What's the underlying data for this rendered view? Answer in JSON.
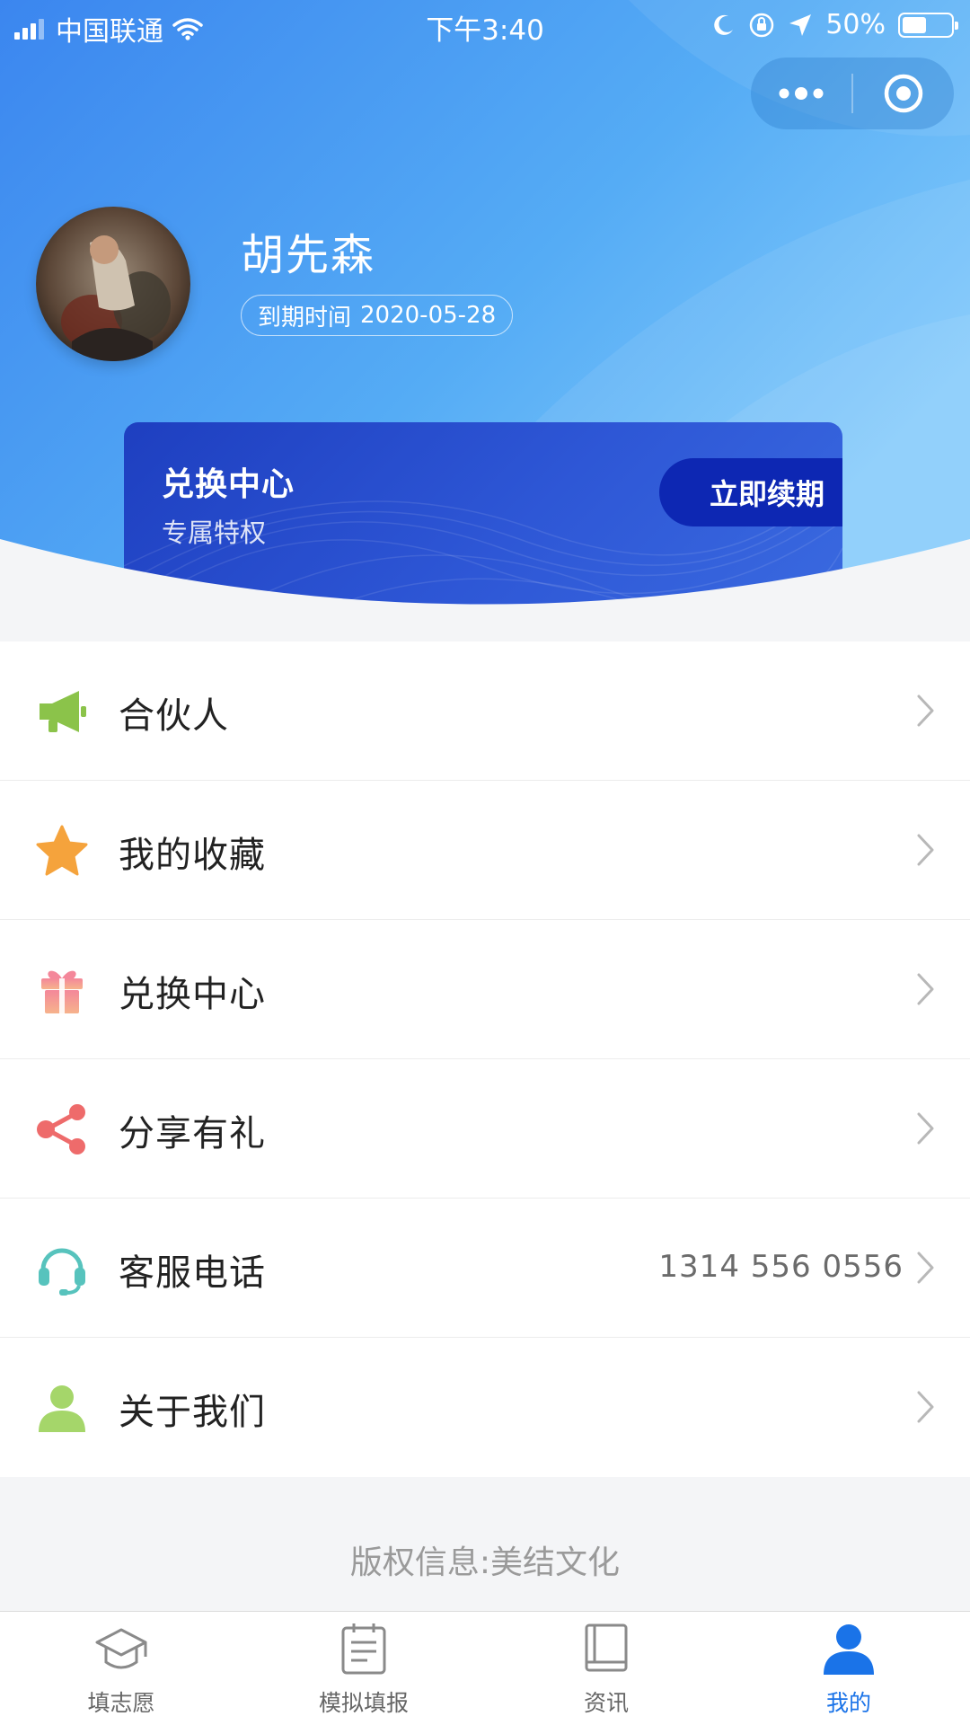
{
  "status_bar": {
    "carrier": "中国联通",
    "time": "下午3:40",
    "battery": "50%",
    "battery_level": 0.5
  },
  "capsule": {
    "more_icon": "more-dots-icon",
    "close_icon": "target-close-icon"
  },
  "profile": {
    "name": "胡先森",
    "expiry_label": "到期时间",
    "expiry_date": "2020-05-28"
  },
  "exchange_card": {
    "title": "兑换中心",
    "subtitle": "专属特权",
    "button_label": "立即续期"
  },
  "menu": [
    {
      "label": "合伙人",
      "value": "",
      "icon": "megaphone-icon",
      "color": "#8bc34a"
    },
    {
      "label": "我的收藏",
      "value": "",
      "icon": "star-icon",
      "color": "#f5a33c"
    },
    {
      "label": "兑换中心",
      "value": "",
      "icon": "gift-icon",
      "color": "#f07a8a"
    },
    {
      "label": "分享有礼",
      "value": "",
      "icon": "share-icon",
      "color": "#ee6b6b"
    },
    {
      "label": "客服电话",
      "value": "1314 556 0556",
      "icon": "headset-icon",
      "color": "#57c3bd"
    },
    {
      "label": "关于我们",
      "value": "",
      "icon": "person-icon",
      "color": "#a5d66a"
    }
  ],
  "copyright": "版权信息:美结文化",
  "tabbar": [
    {
      "label": "填志愿",
      "icon": "graduation-cap-icon",
      "active": false
    },
    {
      "label": "模拟填报",
      "icon": "clipboard-icon",
      "active": false
    },
    {
      "label": "资讯",
      "icon": "book-icon",
      "active": false
    },
    {
      "label": "我的",
      "icon": "person-icon",
      "active": true
    }
  ],
  "colors": {
    "header_blue": "#3f8ff0",
    "card_blue": "#2a4fd0",
    "active_tab": "#1a73e8"
  }
}
